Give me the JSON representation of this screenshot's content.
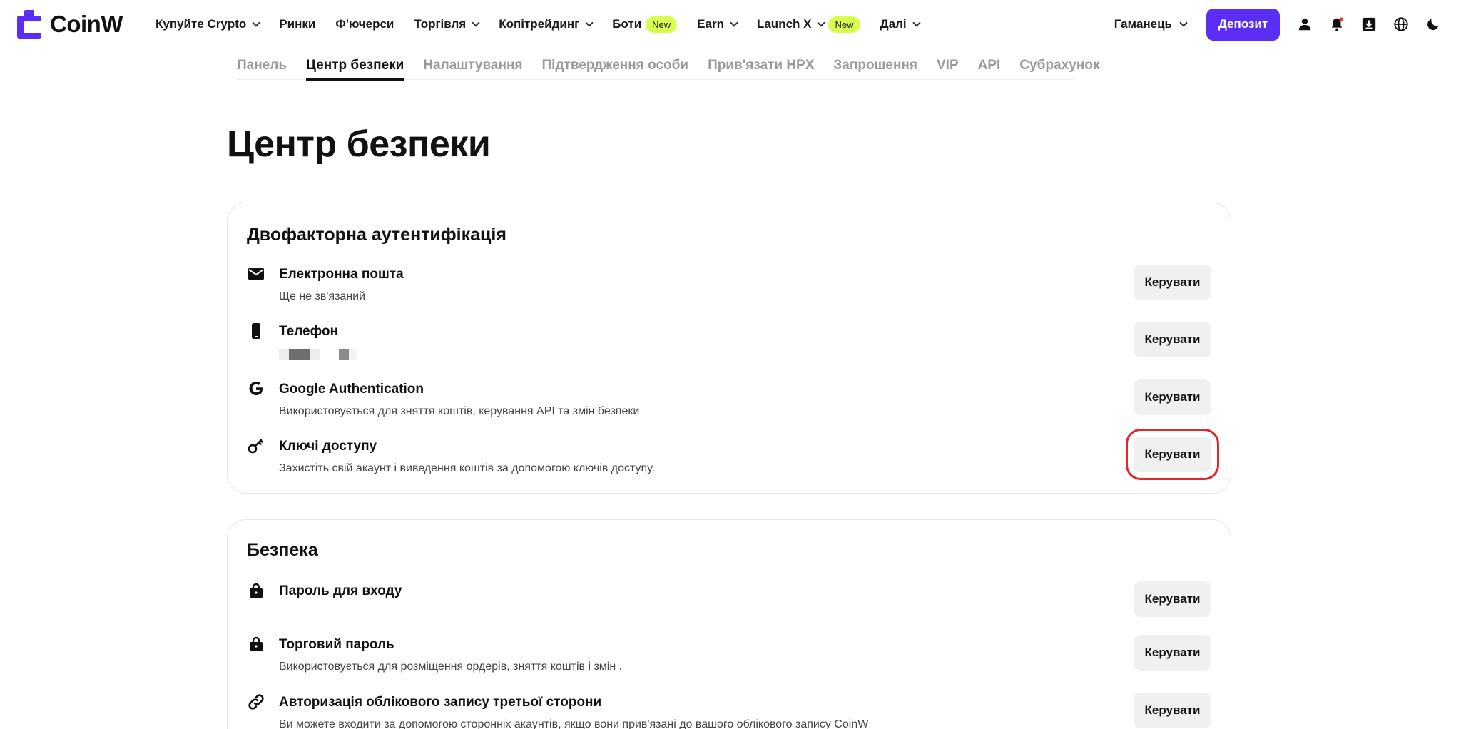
{
  "brand": {
    "name": "CoinW",
    "color": "#5b2df5"
  },
  "nav": {
    "items": [
      {
        "label": "Купуйте Crypto",
        "has_dropdown": true
      },
      {
        "label": "Ринки",
        "has_dropdown": false
      },
      {
        "label": "Ф'ючерси",
        "has_dropdown": false
      },
      {
        "label": "Торгівля",
        "has_dropdown": true
      },
      {
        "label": "Копітрейдинг",
        "has_dropdown": true
      },
      {
        "label": "Боти",
        "badge": "New"
      },
      {
        "label": "Earn",
        "has_dropdown": true
      },
      {
        "label": "Launch X",
        "has_dropdown": true,
        "badge": "New"
      },
      {
        "label": "Далі",
        "has_dropdown": true
      }
    ],
    "wallet_label": "Гаманець",
    "deposit_label": "Депозит",
    "icons": [
      "user-icon",
      "bell-icon",
      "download-icon",
      "globe-icon",
      "moon-icon"
    ],
    "badge_color": "#d8ff4f"
  },
  "subtabs": {
    "items": [
      "Панель",
      "Центр безпеки",
      "Налаштування",
      "Підтвердження особи",
      "Прив'язати HPX",
      "Запрошення",
      "VIP",
      "API",
      "Субрахунок"
    ],
    "active": "Центр безпеки"
  },
  "page": {
    "title": "Центр безпеки"
  },
  "two_factor": {
    "title": "Двофакторна аутентифікація",
    "rows": [
      {
        "icon": "mail-icon",
        "title": "Електронна пошта",
        "subtitle": "Ще не зв'язаний",
        "action": "Керувати"
      },
      {
        "icon": "phone-icon",
        "title": "Телефон",
        "subtitle": "",
        "action": "Керувати"
      },
      {
        "icon": "google-icon",
        "title": "Google Authentication",
        "subtitle": "Використовується для зняття коштів, керування API та змін безпеки",
        "action": "Керувати"
      },
      {
        "icon": "key-icon",
        "title": "Ключі доступу",
        "subtitle": "Захистіть свій акаунт і виведення коштів за допомогою ключів доступу.",
        "action": "Керувати"
      }
    ]
  },
  "security": {
    "title": "Безпека",
    "rows": [
      {
        "icon": "lock-icon",
        "title": "Пароль для входу",
        "subtitle": "",
        "action": "Керувати"
      },
      {
        "icon": "lock-icon",
        "title": "Торговий пароль",
        "subtitle": "Використовується для розміщення ордерів, зняття коштів і змін .",
        "action": "Керувати"
      },
      {
        "icon": "link-icon",
        "title": "Авторизація облікового запису третьої сторони",
        "subtitle": "Ви можете входити за допомогою сторонніх акаунтів, якщо вони прив'язані до вашого облікового запису CoinW",
        "action": "Керувати"
      }
    ]
  },
  "highlight_color": "#e02a2a"
}
